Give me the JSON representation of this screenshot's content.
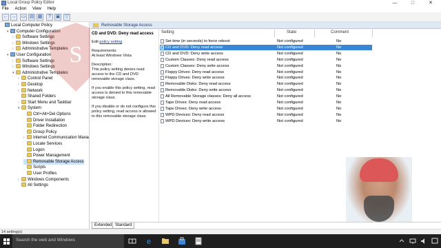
{
  "window": {
    "title": "Local Group Policy Editor",
    "controls": [
      "—",
      "□",
      "✕"
    ]
  },
  "menu": [
    "File",
    "Action",
    "View",
    "Help"
  ],
  "toolbar": {
    "buttons": [
      "back",
      "forward",
      "up",
      "show-hide-tree",
      "export",
      "help",
      "properties",
      "filter"
    ]
  },
  "tree": [
    {
      "label": "Local Computer Policy",
      "level": 0,
      "icon": "computer",
      "arrow": ""
    },
    {
      "label": "Computer Configuration",
      "level": 1,
      "icon": "computer",
      "arrow": "▾"
    },
    {
      "label": "Software Settings",
      "level": 2,
      "icon": "folder",
      "arrow": "›"
    },
    {
      "label": "Windows Settings",
      "level": 2,
      "icon": "folder",
      "arrow": "›"
    },
    {
      "label": "Administrative Templates",
      "level": 2,
      "icon": "folder",
      "arrow": "›"
    },
    {
      "label": "User Configuration",
      "level": 1,
      "icon": "computer",
      "arrow": "▾"
    },
    {
      "label": "Software Settings",
      "level": 2,
      "icon": "folder",
      "arrow": "›"
    },
    {
      "label": "Windows Settings",
      "level": 2,
      "icon": "folder",
      "arrow": "›"
    },
    {
      "label": "Administrative Templates",
      "level": 2,
      "icon": "folder",
      "arrow": "▾"
    },
    {
      "label": "Control Panel",
      "level": 3,
      "icon": "folder",
      "arrow": "›"
    },
    {
      "label": "Desktop",
      "level": 3,
      "icon": "folder",
      "arrow": "›"
    },
    {
      "label": "Network",
      "level": 3,
      "icon": "folder",
      "arrow": "›"
    },
    {
      "label": "Shared Folders",
      "level": 3,
      "icon": "folder",
      "arrow": ""
    },
    {
      "label": "Start Menu and Taskbar",
      "level": 3,
      "icon": "folder",
      "arrow": "›"
    },
    {
      "label": "System",
      "level": 3,
      "icon": "folder",
      "arrow": "▾"
    },
    {
      "label": "Ctrl+Alt+Del Options",
      "level": 4,
      "icon": "folder",
      "arrow": ""
    },
    {
      "label": "Driver Installation",
      "level": 4,
      "icon": "folder",
      "arrow": ""
    },
    {
      "label": "Folder Redirection",
      "level": 4,
      "icon": "folder",
      "arrow": ""
    },
    {
      "label": "Group Policy",
      "level": 4,
      "icon": "folder",
      "arrow": ""
    },
    {
      "label": "Internet Communication Manage",
      "level": 4,
      "icon": "folder",
      "arrow": "›"
    },
    {
      "label": "Locale Services",
      "level": 4,
      "icon": "folder",
      "arrow": ""
    },
    {
      "label": "Logon",
      "level": 4,
      "icon": "folder",
      "arrow": ""
    },
    {
      "label": "Power Management",
      "level": 4,
      "icon": "folder",
      "arrow": ""
    },
    {
      "label": "Removable Storage Access",
      "level": 4,
      "icon": "folder",
      "arrow": "",
      "selected": true
    },
    {
      "label": "Scripts",
      "level": 4,
      "icon": "folder",
      "arrow": ""
    },
    {
      "label": "User Profiles",
      "level": 4,
      "icon": "folder",
      "arrow": ""
    },
    {
      "label": "Windows Components",
      "level": 3,
      "icon": "folder",
      "arrow": "›"
    },
    {
      "label": "All Settings",
      "level": 3,
      "icon": "folder",
      "arrow": ""
    }
  ],
  "right_header": {
    "title": "Removable Storage Access"
  },
  "description": {
    "title": "CD and DVD: Deny read access",
    "edit_prefix": "Edit ",
    "edit_link": "policy setting",
    "requirements_label": "Requirements:",
    "requirements_value": "At least Windows Vista",
    "description_label": "Description:",
    "description_text": "This policy setting denies read access to the CD and DVD removable storage class.",
    "enabled_text": "If you enable this policy setting, read access is denied to this removable storage class.",
    "disabled_text": "If you disable or do not configure this policy setting, read access is allowed to this removable storage class."
  },
  "columns": {
    "setting": "Setting",
    "state": "State",
    "comment": "Comment"
  },
  "settings": [
    {
      "name": "Set time (in seconds) to force reboot",
      "state": "Not configured",
      "comment": "No"
    },
    {
      "name": "CD and DVD: Deny read access",
      "state": "Not configured",
      "comment": "No",
      "selected": true
    },
    {
      "name": "CD and DVD: Deny write access",
      "state": "Not configured",
      "comment": "No"
    },
    {
      "name": "Custom Classes: Deny read access",
      "state": "Not configured",
      "comment": "No"
    },
    {
      "name": "Custom Classes: Deny write access",
      "state": "Not configured",
      "comment": "No"
    },
    {
      "name": "Floppy Drives: Deny read access",
      "state": "Not configured",
      "comment": "No"
    },
    {
      "name": "Floppy Drives: Deny write access",
      "state": "Not configured",
      "comment": "No"
    },
    {
      "name": "Removable Disks: Deny read access",
      "state": "Not configured",
      "comment": "No"
    },
    {
      "name": "Removable Disks: Deny write access",
      "state": "Not configured",
      "comment": "No"
    },
    {
      "name": "All Removable Storage classes: Deny all access",
      "state": "Not configured",
      "comment": "No"
    },
    {
      "name": "Tape Drives: Deny read access",
      "state": "Not configured",
      "comment": "No"
    },
    {
      "name": "Tape Drives: Deny write access",
      "state": "Not configured",
      "comment": "No"
    },
    {
      "name": "WPD Devices: Deny read access",
      "state": "Not configured",
      "comment": "No"
    },
    {
      "name": "WPD Devices: Deny write access",
      "state": "Not configured",
      "comment": "No"
    }
  ],
  "tabs": [
    "Extended",
    "Standard"
  ],
  "status": "14 setting(s)",
  "taskbar": {
    "search_placeholder": "Search the web and Windows",
    "apps": [
      "task-view-icon",
      "edge-icon",
      "file-explorer-icon",
      "store-icon",
      "notepad-icon"
    ]
  },
  "colors": {
    "selection": "#3a86d6",
    "header_bg": "#dfe8f5",
    "taskbar": "#1f1f1f",
    "link": "#0645ad"
  }
}
